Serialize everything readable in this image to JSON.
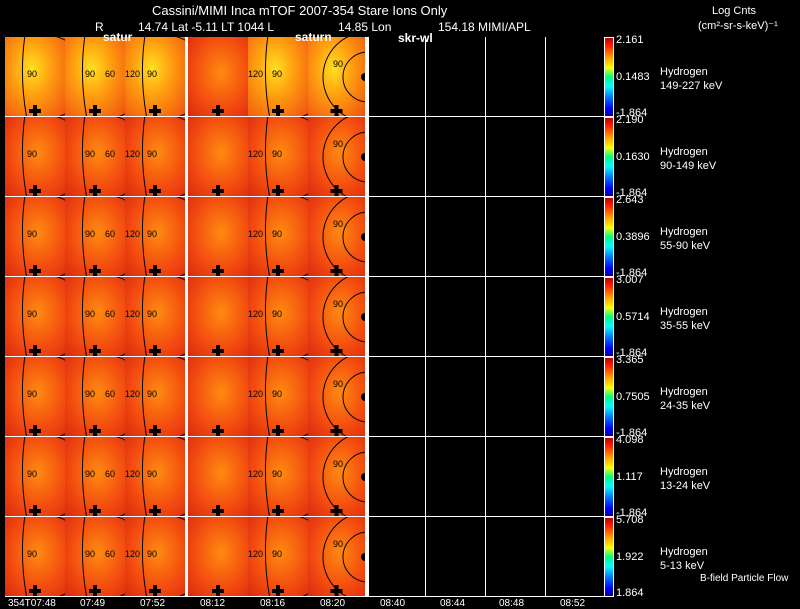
{
  "header": {
    "title": "Cassini/MIMI Inca mTOF  2007-354   Stare   Ions Only",
    "r": "R",
    "lat": "14.74 Lat -5.11 LT 1044 L",
    "lon": "14.85 Lon",
    "lonval": "154.18  MIMI/APL",
    "overlay1": "satur",
    "overlay2": "saturn",
    "overlay3": "skr-wl"
  },
  "units": {
    "line1": "Log Cnts",
    "line2": "(cm²-sr-s-keV)⁻¹"
  },
  "footer": {
    "note": "B-field Particle Flow"
  },
  "colors": {
    "background": "#000000",
    "panel": "#f24a10"
  },
  "chart_data": {
    "type": "heatmap",
    "title": "Cassini/MIMI Inca mTOF 2007-354 Stare Ions Only",
    "x_ticks": [
      "354T07:48",
      "07:49",
      "07:52",
      "08:12",
      "08:16",
      "08:20",
      "08:40",
      "08:44",
      "08:48",
      "08:52"
    ],
    "contour_labels": [
      [
        "90"
      ],
      [
        "90",
        "60"
      ],
      [
        "120",
        "90"
      ],
      [],
      [
        "120",
        "90"
      ],
      [
        "90"
      ]
    ],
    "rows": [
      {
        "species": "Hydrogen",
        "energy": "149-227 keV",
        "max": "2.161",
        "mid": "0.1483",
        "min": "-1.864"
      },
      {
        "species": "Hydrogen",
        "energy": "90-149 keV",
        "max": "2.190",
        "mid": "0.1630",
        "min": "-1.864"
      },
      {
        "species": "Hydrogen",
        "energy": "55-90 keV",
        "max": "2.643",
        "mid": "0.3896",
        "min": "-1.864"
      },
      {
        "species": "Hydrogen",
        "energy": "35-55 keV",
        "max": "3.007",
        "mid": "0.5714",
        "min": "-1.864"
      },
      {
        "species": "Hydrogen",
        "energy": "24-35 keV",
        "max": "3.365",
        "mid": "0.7505",
        "min": "-1.864"
      },
      {
        "species": "Hydrogen",
        "energy": "13-24 keV",
        "max": "4.098",
        "mid": "1.117",
        "min": "-1.864"
      },
      {
        "species": "Hydrogen",
        "energy": "5-13 keV",
        "max": "5.708",
        "mid": "1.922",
        "min": "1.864"
      }
    ]
  }
}
